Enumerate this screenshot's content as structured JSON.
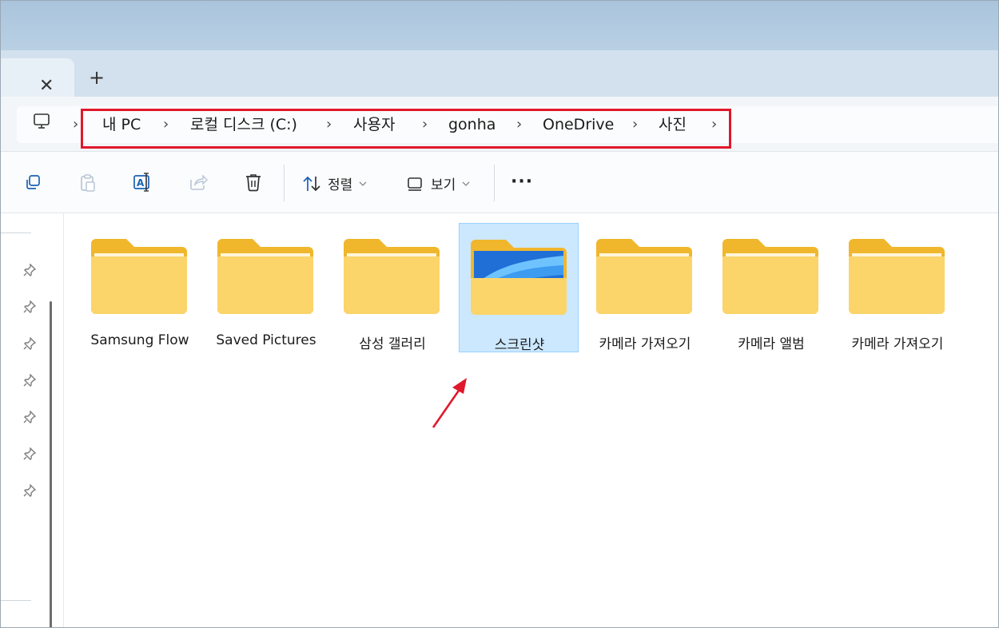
{
  "window": {
    "tab": {
      "close_glyph": "✕",
      "new_glyph": "+"
    }
  },
  "breadcrumb": {
    "root_icon": "computer-icon",
    "separator": "›",
    "items": [
      "내 PC",
      "로컬 디스크 (C:)",
      "사용자",
      "gonha",
      "OneDrive",
      "사진"
    ],
    "highlight_color": "#e0182c"
  },
  "toolbar": {
    "icons": [
      "copy-icon",
      "paste-icon",
      "rename-icon",
      "share-icon",
      "delete-icon"
    ],
    "sort_label": "정렬",
    "view_label": "보기",
    "more_label": "···"
  },
  "folders": [
    {
      "name": "Samsung Flow",
      "selected": false
    },
    {
      "name": "Saved Pictures",
      "selected": false
    },
    {
      "name": "삼성 갤러리",
      "selected": false
    },
    {
      "name": "스크린샷",
      "selected": true
    },
    {
      "name": "카메라 가져오기",
      "selected": false
    },
    {
      "name": "카메라 앨범",
      "selected": false
    },
    {
      "name": "카메라 가져오기",
      "selected": false
    }
  ],
  "colors": {
    "folder_back": "#f0b72d",
    "folder_front": "#fbd46a",
    "selection_bg": "#cce8ff",
    "annotation_red": "#e0182c"
  }
}
